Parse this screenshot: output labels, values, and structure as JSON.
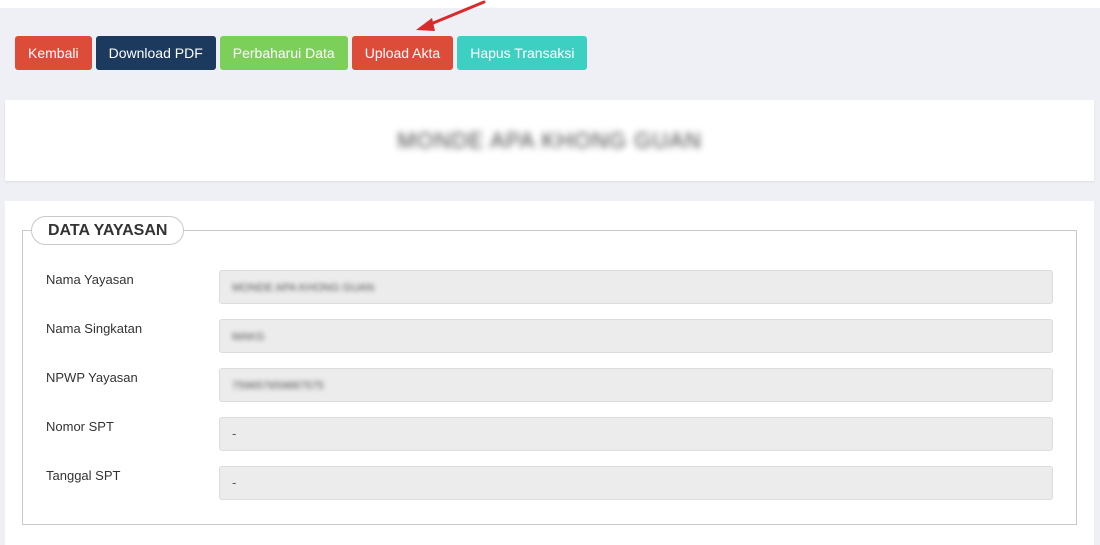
{
  "toolbar": {
    "buttons": [
      {
        "label": "Kembali",
        "color": "#dd4b39"
      },
      {
        "label": "Download PDF",
        "color": "#1b3a5e"
      },
      {
        "label": "Perbaharui Data",
        "color": "#7cd05a"
      },
      {
        "label": "Upload Akta",
        "color": "#dd4b39"
      },
      {
        "label": "Hapus Transaksi",
        "color": "#3ecfc3"
      }
    ]
  },
  "header": {
    "title": "MONDE APA KHONG GUAN"
  },
  "section": {
    "legend": "DATA YAYASAN",
    "fields": [
      {
        "label": "Nama Yayasan",
        "value": "MONDE APA KHONG GUAN"
      },
      {
        "label": "Nama Singkatan",
        "value": "MAKG"
      },
      {
        "label": "NPWP Yayasan",
        "value": "759657659887575"
      },
      {
        "label": "Nomor SPT",
        "value": "-"
      },
      {
        "label": "Tanggal SPT",
        "value": "-"
      }
    ]
  },
  "annotation": {
    "arrow_color": "#d92b2b",
    "arrow_target": "Upload Akta"
  }
}
